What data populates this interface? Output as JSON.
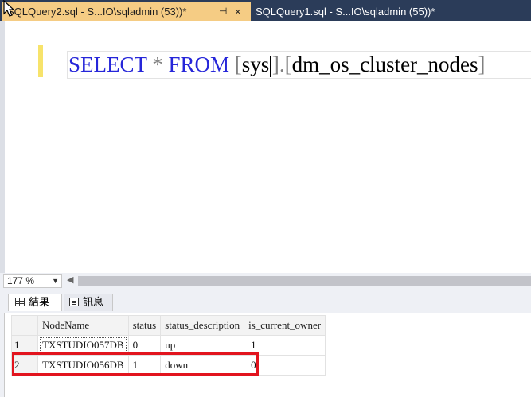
{
  "tabs": [
    {
      "label": "SQLQuery2.sql - S...IO\\sqladmin (53))*",
      "active": true
    },
    {
      "label": "SQLQuery1.sql - S...IO\\sqladmin (55))*",
      "active": false
    }
  ],
  "tab_controls": {
    "pin": "⊣",
    "close": "×"
  },
  "editor": {
    "keyword_select": "SELECT",
    "star": "*",
    "keyword_from": "FROM",
    "bracket_open1": "[",
    "schema": "sys",
    "bracket_close1": "]",
    "dot": ".",
    "bracket_open2": "[",
    "object": "dm_os_cluster_nodes",
    "bracket_close2": "]"
  },
  "zoom": {
    "value": "177 %"
  },
  "results_tabs": {
    "results": "結果",
    "messages": "訊息"
  },
  "grid": {
    "columns": [
      "NodeName",
      "status",
      "status_description",
      "is_current_owner"
    ],
    "rows": [
      {
        "num": "1",
        "NodeName": "TXSTUDIO057DB",
        "status": "0",
        "status_description": "up",
        "is_current_owner": "1"
      },
      {
        "num": "2",
        "NodeName": "TXSTUDIO056DB",
        "status": "1",
        "status_description": "down",
        "is_current_owner": "0"
      }
    ]
  },
  "colors": {
    "highlight_box": "#e2141e",
    "active_tab": "#f5cc84",
    "tab_strip": "#2b3c59",
    "keyword": "#2626d9"
  }
}
